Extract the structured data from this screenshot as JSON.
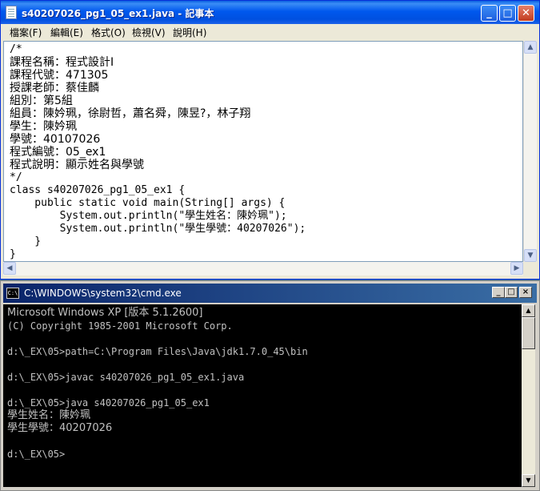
{
  "notepad": {
    "title": "s40207026_pg1_05_ex1.java - 記事本",
    "menu": [
      "檔案(F)",
      "編輯(E)",
      "格式(O)",
      "檢視(V)",
      "說明(H)"
    ],
    "lines": [
      "/*",
      "課程名稱：程式設計I",
      "課程代號：471305",
      "授課老師：蔡佳麟",
      "組別：第5組",
      "組員：陳妗珮，徐尉哲，蕭名舜，陳昱?，林子翔",
      "學生：陳妗珮",
      "學號：40107026",
      "程式編號：05_ex1",
      "程式說明：顯示姓名與學號",
      "*/",
      "class s40207026_pg1_05_ex1 {",
      "    public static void main(String[] args) {",
      "        System.out.println(\"學生姓名：陳妗珮\");",
      "        System.out.println(\"學生學號：40207026\");",
      "    }",
      "}"
    ]
  },
  "cmd": {
    "title": "C:\\WINDOWS\\system32\\cmd.exe",
    "lines": [
      "Microsoft Windows XP [版本 5.1.2600]",
      "(C) Copyright 1985-2001 Microsoft Corp.",
      "",
      "d:\\_EX\\05>path=C:\\Program Files\\Java\\jdk1.7.0_45\\bin",
      "",
      "d:\\_EX\\05>javac s40207026_pg1_05_ex1.java",
      "",
      "d:\\_EX\\05>java s40207026_pg1_05_ex1",
      "學生姓名：陳妗珮",
      "學生學號：40207026",
      "",
      "d:\\_EX\\05>"
    ]
  }
}
